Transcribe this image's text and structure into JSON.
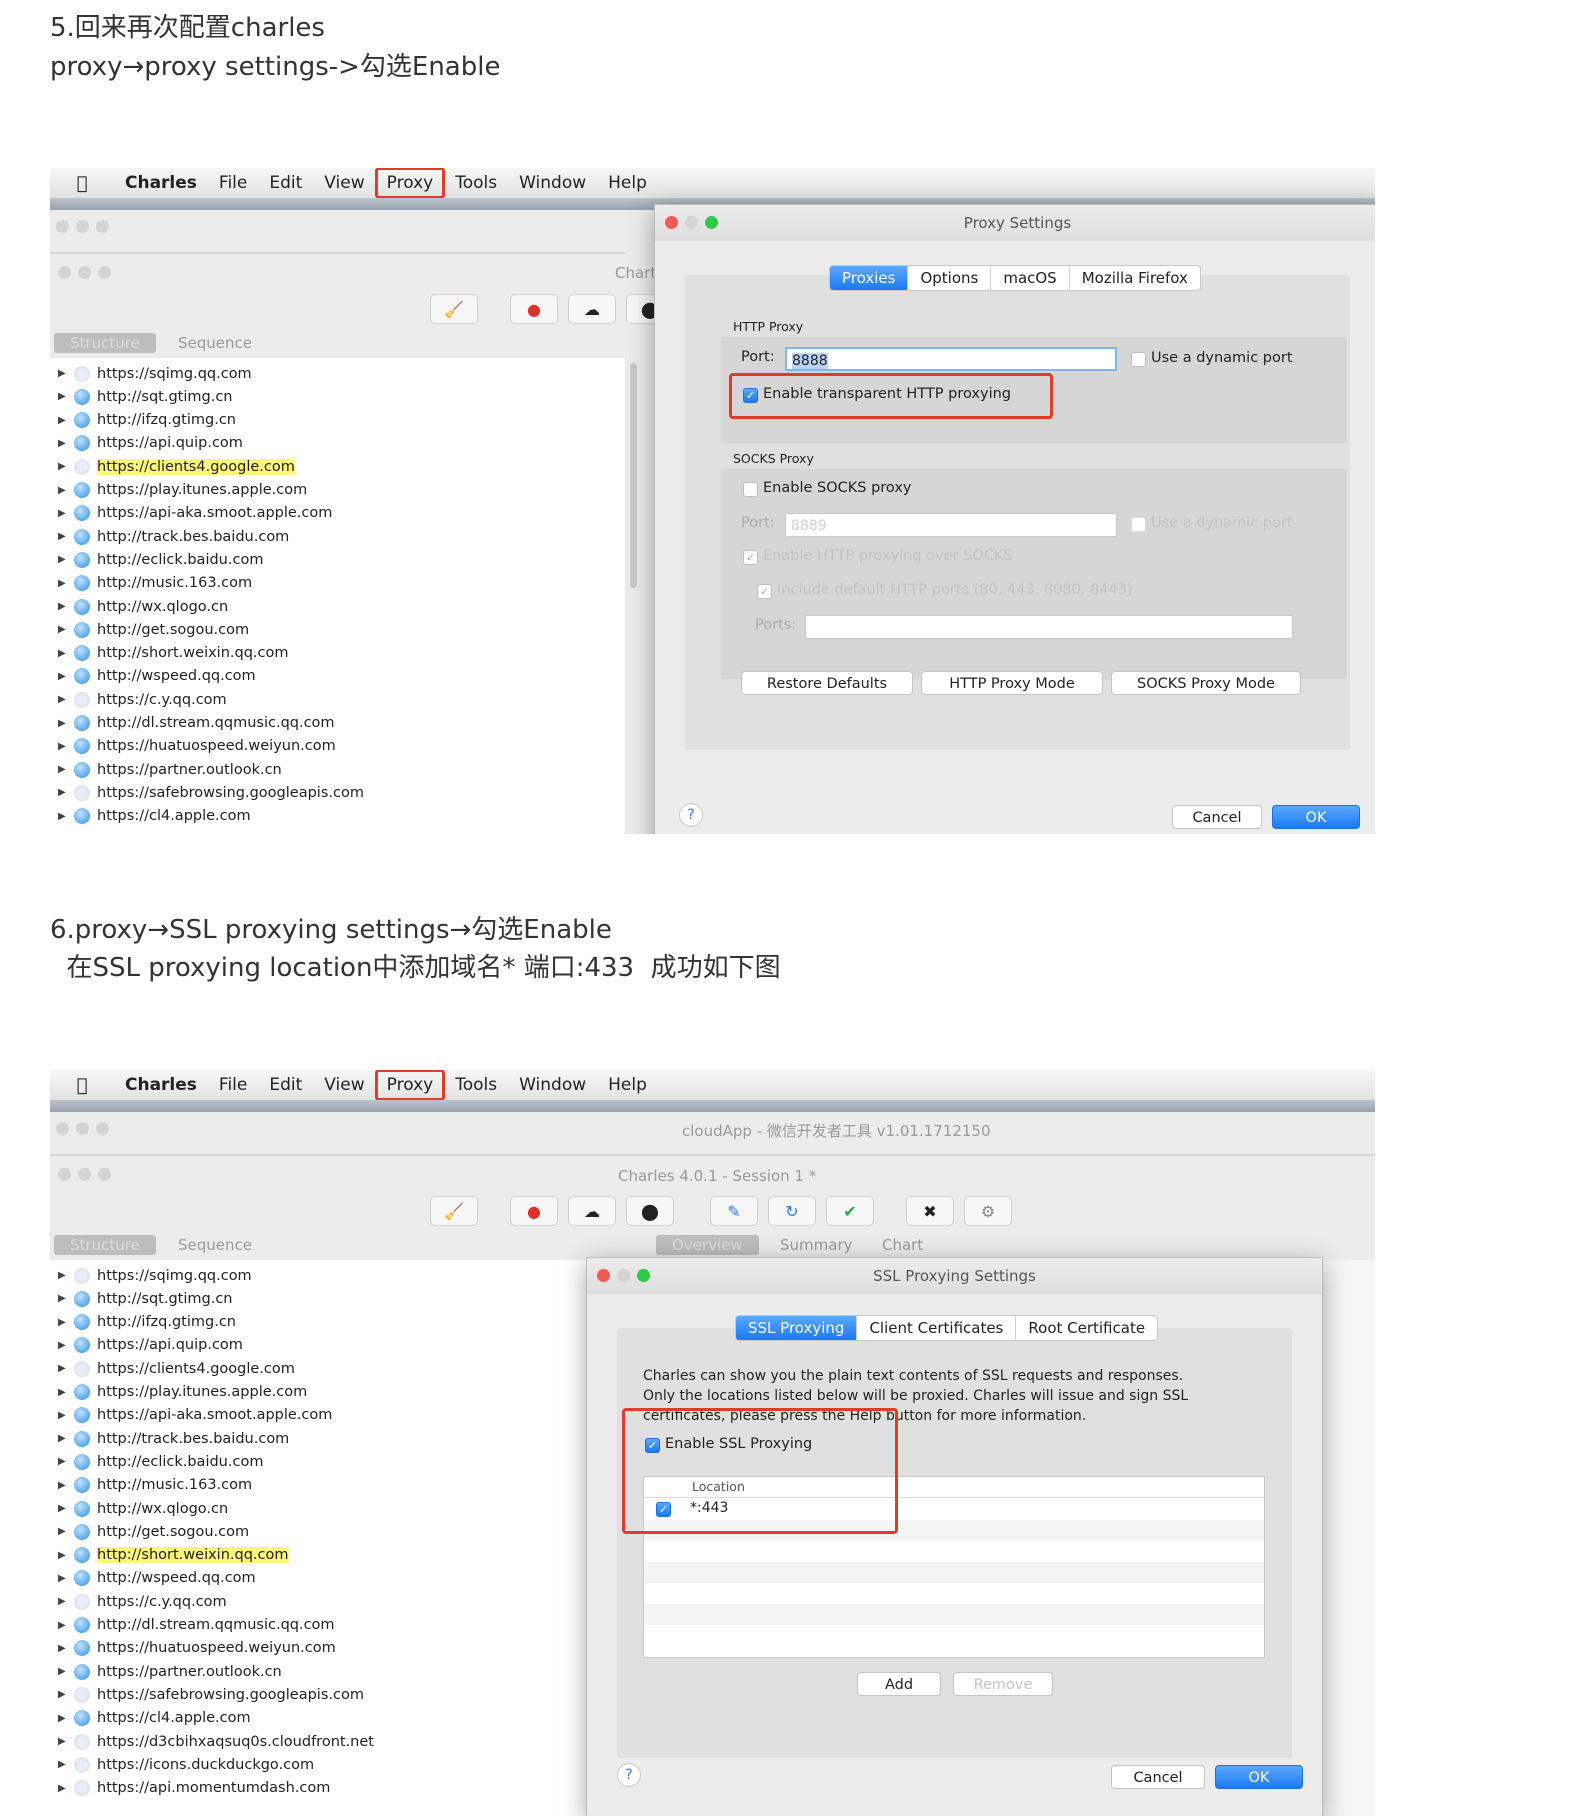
{
  "section5": {
    "line1": "5.回来再次配置charles",
    "line2": "proxy→proxy settings->勾选Enable"
  },
  "section6": {
    "line1": "6.proxy→SSL proxying settings→勾选Enable",
    "line2": "  在SSL proxying location中添加域名* 端口:433  成功如下图"
  },
  "menubar": {
    "app": "Charles",
    "items": [
      "File",
      "Edit",
      "View",
      "Proxy",
      "Tools",
      "Window",
      "Help"
    ]
  },
  "shot1": {
    "window_title": "Chart",
    "tabs": [
      "Structure",
      "Sequence"
    ],
    "hosts": [
      {
        "url": "https://sqimg.qq.com",
        "secure": true
      },
      {
        "url": "http://sqt.gtimg.cn",
        "secure": false
      },
      {
        "url": "http://ifzq.gtimg.cn",
        "secure": false
      },
      {
        "url": "https://api.quip.com",
        "secure": false
      },
      {
        "url": "https://clients4.google.com",
        "secure": true,
        "highlight": true
      },
      {
        "url": "https://play.itunes.apple.com",
        "secure": false
      },
      {
        "url": "https://api-aka.smoot.apple.com",
        "secure": false
      },
      {
        "url": "http://track.bes.baidu.com",
        "secure": false
      },
      {
        "url": "http://eclick.baidu.com",
        "secure": false
      },
      {
        "url": "http://music.163.com",
        "secure": false
      },
      {
        "url": "http://wx.qlogo.cn",
        "secure": false
      },
      {
        "url": "http://get.sogou.com",
        "secure": false
      },
      {
        "url": "http://short.weixin.qq.com",
        "secure": false
      },
      {
        "url": "http://wspeed.qq.com",
        "secure": false
      },
      {
        "url": "https://c.y.qq.com",
        "secure": true
      },
      {
        "url": "http://dl.stream.qqmusic.qq.com",
        "secure": false
      },
      {
        "url": "https://huatuospeed.weiyun.com",
        "secure": false
      },
      {
        "url": "https://partner.outlook.cn",
        "secure": false
      },
      {
        "url": "https://safebrowsing.googleapis.com",
        "secure": true
      },
      {
        "url": "https://cl4.apple.com",
        "secure": false
      }
    ],
    "dialog": {
      "title": "Proxy Settings",
      "tabs": [
        "Proxies",
        "Options",
        "macOS",
        "Mozilla Firefox"
      ],
      "http_section": "HTTP Proxy",
      "port_label": "Port:",
      "port_value": "8888",
      "dynamic_port": "Use a dynamic port",
      "transparent": "Enable transparent HTTP proxying",
      "socks_section": "SOCKS Proxy",
      "enable_socks": "Enable SOCKS proxy",
      "socks_port_value": "8889",
      "socks_dynamic": "Use a dynamic port",
      "http_over_socks": "Enable HTTP proxying over SOCKS",
      "include_ports": "Include default HTTP ports (80, 443, 8080, 8443)",
      "ports_label": "Ports:",
      "restore": "Restore Defaults",
      "http_mode": "HTTP Proxy Mode",
      "socks_mode": "SOCKS Proxy Mode",
      "help": "?",
      "cancel": "Cancel",
      "ok": "OK"
    }
  },
  "shot2": {
    "top_title": "cloudApp - 微信开发者工具 v1.01.1712150",
    "window_title": "Charles 4.0.1 - Session 1 *",
    "tabs": [
      "Structure",
      "Sequence"
    ],
    "right_tabs": [
      "Overview",
      "Summary",
      "Chart"
    ],
    "hosts": [
      {
        "url": "https://sqimg.qq.com",
        "secure": true
      },
      {
        "url": "http://sqt.gtimg.cn",
        "secure": false
      },
      {
        "url": "http://ifzq.gtimg.cn",
        "secure": false
      },
      {
        "url": "https://api.quip.com",
        "secure": false
      },
      {
        "url": "https://clients4.google.com",
        "secure": true
      },
      {
        "url": "https://play.itunes.apple.com",
        "secure": false
      },
      {
        "url": "https://api-aka.smoot.apple.com",
        "secure": false
      },
      {
        "url": "http://track.bes.baidu.com",
        "secure": false
      },
      {
        "url": "http://eclick.baidu.com",
        "secure": false
      },
      {
        "url": "http://music.163.com",
        "secure": false
      },
      {
        "url": "http://wx.qlogo.cn",
        "secure": false
      },
      {
        "url": "http://get.sogou.com",
        "secure": false
      },
      {
        "url": "http://short.weixin.qq.com",
        "secure": false,
        "highlight": true
      },
      {
        "url": "http://wspeed.qq.com",
        "secure": false
      },
      {
        "url": "https://c.y.qq.com",
        "secure": true
      },
      {
        "url": "http://dl.stream.qqmusic.qq.com",
        "secure": false
      },
      {
        "url": "https://huatuospeed.weiyun.com",
        "secure": false
      },
      {
        "url": "https://partner.outlook.cn",
        "secure": false
      },
      {
        "url": "https://safebrowsing.googleapis.com",
        "secure": true
      },
      {
        "url": "https://cl4.apple.com",
        "secure": false
      },
      {
        "url": "https://d3cbihxaqsuq0s.cloudfront.net",
        "secure": true
      },
      {
        "url": "https://icons.duckduckgo.com",
        "secure": true
      },
      {
        "url": "https://api.momentumdash.com",
        "secure": true
      }
    ],
    "dialog": {
      "title": "SSL Proxying Settings",
      "tabs": [
        "SSL Proxying",
        "Client Certificates",
        "Root Certificate"
      ],
      "desc1": "Charles can show you the plain text contents of SSL requests and responses.",
      "desc2": "Only the locations listed below will be proxied. Charles will issue and sign SSL",
      "desc3": "certificates, please press the Help button for more information.",
      "enable": "Enable SSL Proxying",
      "location_header": "Location",
      "location_value": "*:443",
      "add": "Add",
      "remove": "Remove",
      "help": "?",
      "cancel": "Cancel",
      "ok": "OK"
    }
  }
}
